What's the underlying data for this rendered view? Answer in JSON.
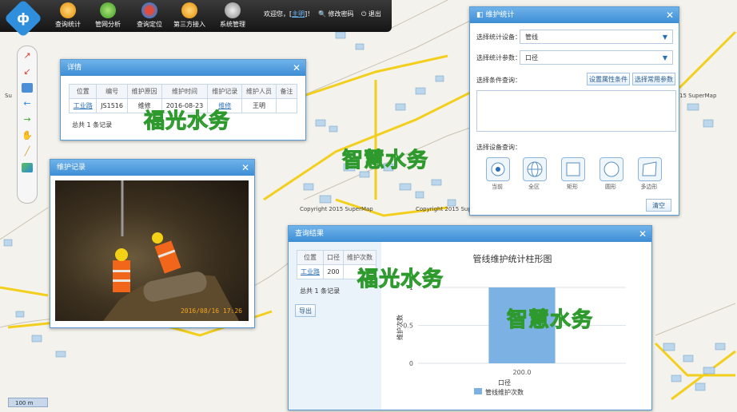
{
  "toolbar": {
    "logo": "ф",
    "items": [
      "查询统计",
      "管网分析",
      "查询定位",
      "第三方接入",
      "系统管理"
    ],
    "welcome": "欢迎您，[",
    "user": "主明",
    "welcome_end": "]！",
    "change_password": "修改密码",
    "logout": "退出"
  },
  "map": {
    "scale": "100 m",
    "copyright": "Copyright 2015 SuperMap",
    "supermap_right": "15 SuperMap",
    "supermap_left": "Su"
  },
  "detail_window": {
    "title": "详情",
    "columns": [
      "位置",
      "编号",
      "维护原因",
      "维护时间",
      "维护记录",
      "维护人员",
      "备注"
    ],
    "row": [
      "工业路",
      "JS1516",
      "维修",
      "2016-08-23",
      "维修",
      "王明",
      ""
    ],
    "total": "总共 1 条记录"
  },
  "photo_window": {
    "title": "维护记录",
    "timestamp": "2016/08/16 17:26"
  },
  "stats_window": {
    "title": "维护统计",
    "device_label": "选择统计设备：",
    "device_value": "管线",
    "param_label": "选择统计参数：",
    "param_value": "口径",
    "condition_label": "选择条件查询：",
    "set_attr_btn": "设置属性条件",
    "common_param_btn": "选择常用参数",
    "device_query_label": "选择设备查询：",
    "shapes": [
      "当前",
      "全区",
      "矩形",
      "圆形",
      "多边形"
    ],
    "clear_btn": "清空"
  },
  "result_window": {
    "title": "查询结果",
    "columns": [
      "位置",
      "口径",
      "维护次数"
    ],
    "row": [
      "工业路",
      "200",
      "1"
    ],
    "total": "总共 1 条记录",
    "export_btn": "导出"
  },
  "watermarks": [
    "福光水务",
    "智慧水务",
    "福光水务",
    "智慧水务"
  ],
  "chart_data": {
    "type": "bar",
    "title": "管线维护统计柱形图",
    "categories": [
      "200.0"
    ],
    "series": [
      {
        "name": "管线维护次数",
        "values": [
          1
        ]
      }
    ],
    "xlabel": "口径",
    "ylabel": "维护次数",
    "ylim": [
      0,
      1
    ],
    "yticks": [
      "0",
      "0.5",
      "1"
    ],
    "legend": "bottom",
    "color": "#7cb1e3"
  }
}
